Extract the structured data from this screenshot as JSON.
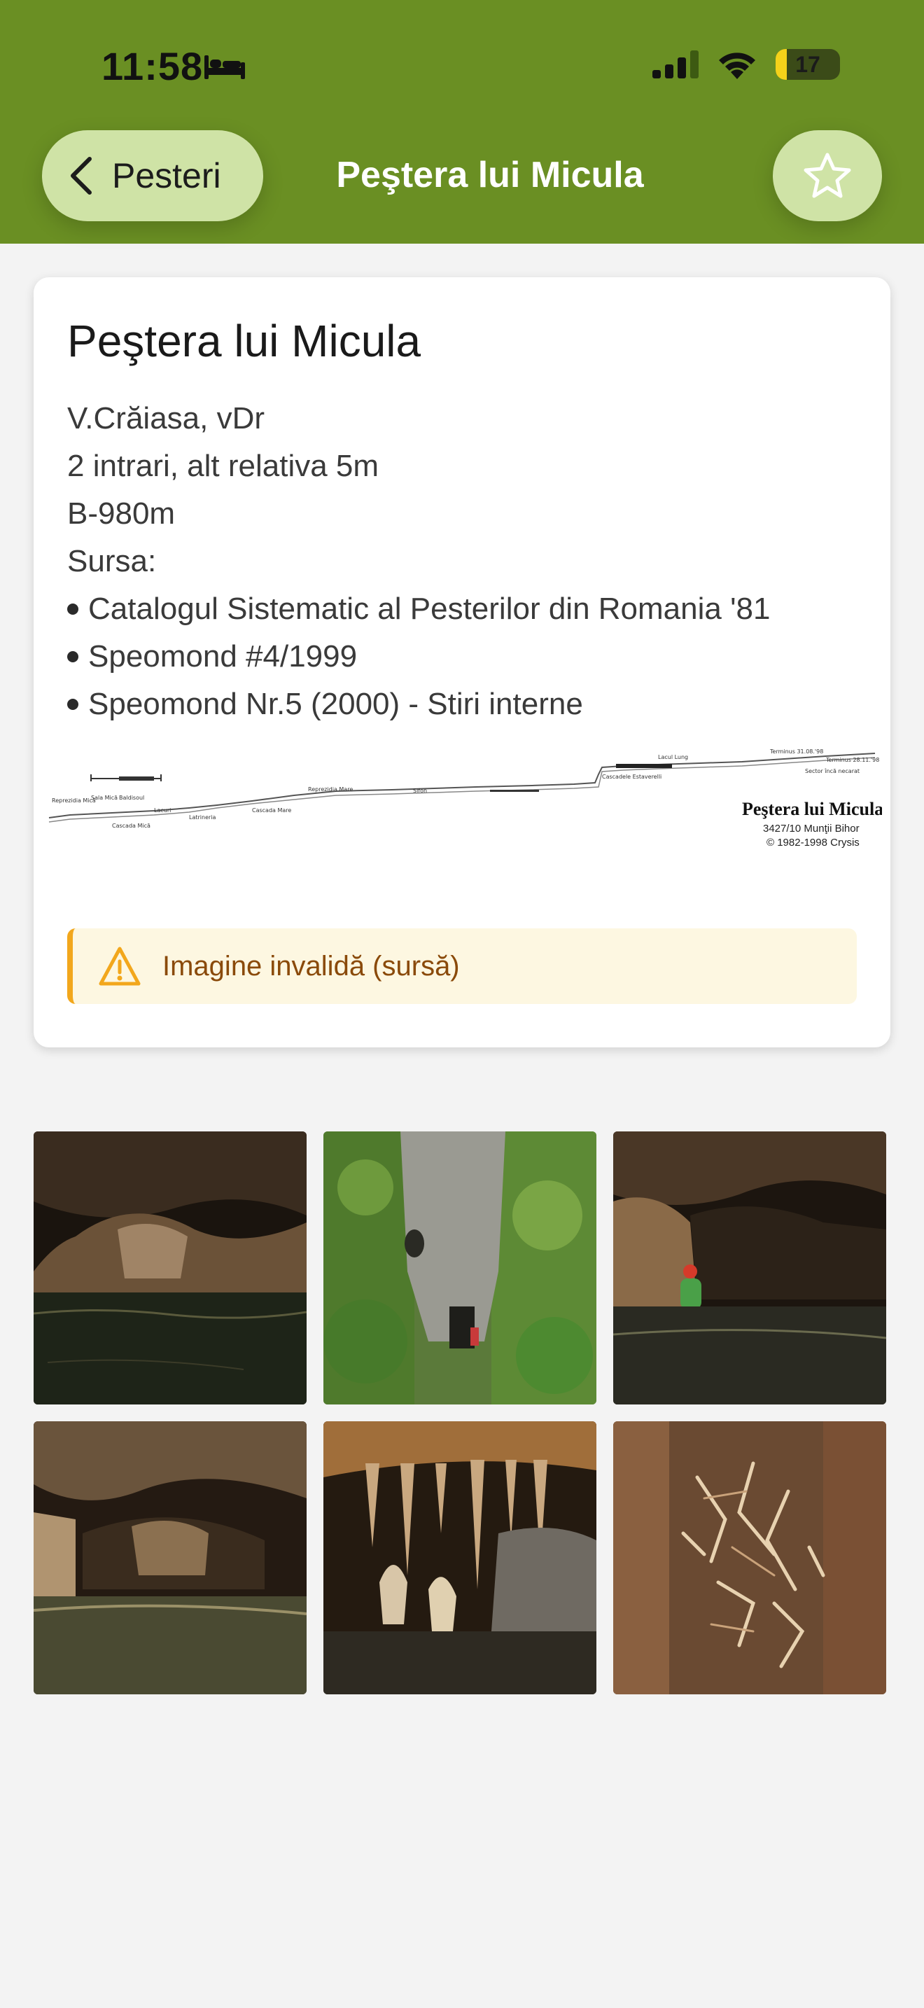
{
  "status_bar": {
    "time": "11:58",
    "battery": "17",
    "battery_level": 0.17
  },
  "nav": {
    "back_label": "Pesteri",
    "title": "Peştera lui Micula",
    "favorite_icon": "star-outline-icon"
  },
  "card": {
    "title": "Peştera lui Micula",
    "lines": [
      "V.Crăiasa, vDr",
      "2 intrari, alt relativa 5m",
      "B-980m",
      "Sursa:"
    ],
    "sources": [
      "Catalogul Sistematic al Pesterilor din Romania '81",
      "Speomond #4/1999",
      "Speomond Nr.5 (2000) - Stiri interne"
    ],
    "map": {
      "title": "Peştera lui Micula",
      "subtitle1": "3427/10 Munţii Bihor",
      "subtitle2": "© 1982-1998 Crysis",
      "labels": [
        "Reprezidia Mică",
        "Sala Mică",
        "Baldisoul",
        "Lacuri",
        "Cascada Mică",
        "Latrineria",
        "Cascada Mare",
        "Reprezidia Mare",
        "Sifon",
        "Cascadele Estaverelli",
        "Lacul Lung",
        "Terminus 31.08.'98",
        "Terminus 28.11.'98",
        "Sector încă necarat"
      ]
    },
    "warning": {
      "text": "Imagine invalidă (sursă)",
      "icon": "warning-triangle-icon"
    }
  },
  "gallery": {
    "photos": [
      {
        "name": "cave-lake-dark",
        "icon": "photo"
      },
      {
        "name": "cave-entrance-forest",
        "icon": "photo"
      },
      {
        "name": "caver-in-water",
        "icon": "photo"
      },
      {
        "name": "underground-lake",
        "icon": "photo"
      },
      {
        "name": "stalactites",
        "icon": "photo"
      },
      {
        "name": "aragonite-crystals",
        "icon": "photo"
      }
    ]
  },
  "colors": {
    "header": "#6a8f23",
    "button": "#cfe3a6",
    "warning_bg": "#fdf7e1",
    "warning_border": "#f2a71c"
  }
}
